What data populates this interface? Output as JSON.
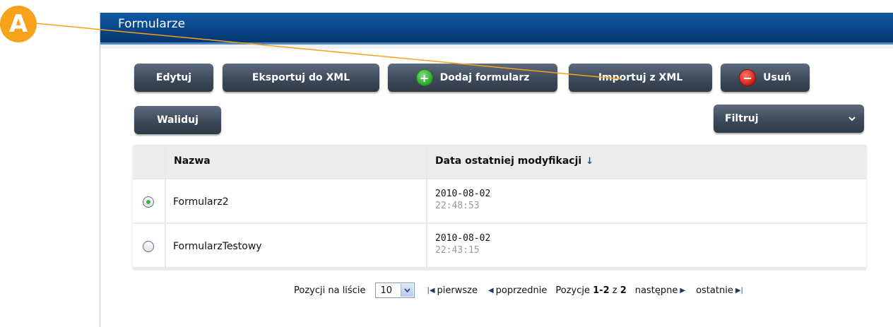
{
  "callout": {
    "label": "A"
  },
  "panel": {
    "title": "Formularze"
  },
  "toolbar": {
    "edit_label": "Edytuj",
    "export_label": "Eksportuj do XML",
    "add_label": "Dodaj formularz",
    "import_label": "Importuj z XML",
    "delete_label": "Usuń",
    "validate_label": "Waliduj",
    "filter_label": "Filtruj"
  },
  "table": {
    "columns": [
      "Nazwa",
      "Data ostatniej modyfikacji"
    ],
    "sort_indicator": "↓",
    "rows": [
      {
        "name": "Formularz2",
        "date": "2010-08-02",
        "time": "22:48:53",
        "selected": true
      },
      {
        "name": "FormularzTestowy",
        "date": "2010-08-02",
        "time": "22:43:15",
        "selected": false
      }
    ]
  },
  "pager": {
    "per_page_label": "Pozycji na liście",
    "per_page_value": "10",
    "first_label": "pierwsze",
    "prev_label": "poprzednie",
    "positions_label": "Pozycje",
    "range": "1-2",
    "of_label": "z",
    "total": "2",
    "next_label": "następne",
    "last_label": "ostatnie"
  },
  "colors": {
    "header_blue": "#0a4589",
    "button_gray": "#3d4a5a",
    "callout_orange": "#f7a21b",
    "add_green": "#2ea52a",
    "delete_red": "#d01c12"
  }
}
